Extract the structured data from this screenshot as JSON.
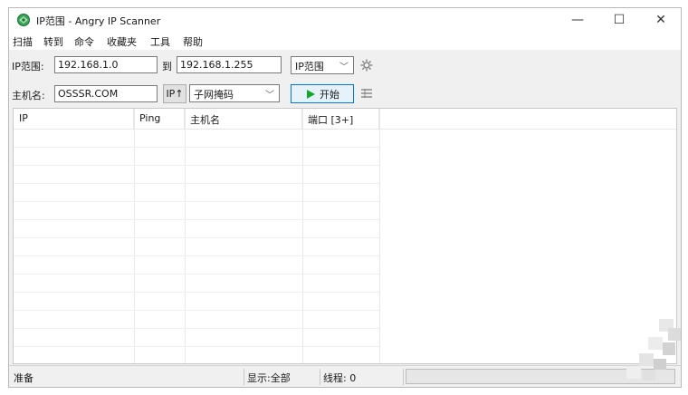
{
  "window": {
    "title": "IP范围 - Angry IP Scanner",
    "controls": {
      "minimize": "—",
      "maximize": "☐",
      "close": "✕"
    }
  },
  "menu": [
    "扫描",
    "转到",
    "命令",
    "收藏夹",
    "工具",
    "帮助"
  ],
  "toolbar": {
    "ip_range_label": "IP范围:",
    "start_ip": "192.168.1.0",
    "to_label": "到",
    "end_ip": "192.168.1.255",
    "feeder_select": "IP范围",
    "hostname_label": "主机名:",
    "hostname": "OSSSR.COM",
    "ip_up_button": "IP↑",
    "netmask_select": "子网掩码",
    "start_button": "开始",
    "icons": {
      "settings": "gear-icon",
      "fetchers": "list-columns-icon",
      "start": "play-icon"
    }
  },
  "table": {
    "columns": [
      "IP",
      "Ping",
      "主机名",
      "端口 [3+]"
    ],
    "rows": []
  },
  "status": {
    "state": "准备",
    "display": "显示:全部",
    "threads": "线程: 0",
    "progress": 0
  }
}
